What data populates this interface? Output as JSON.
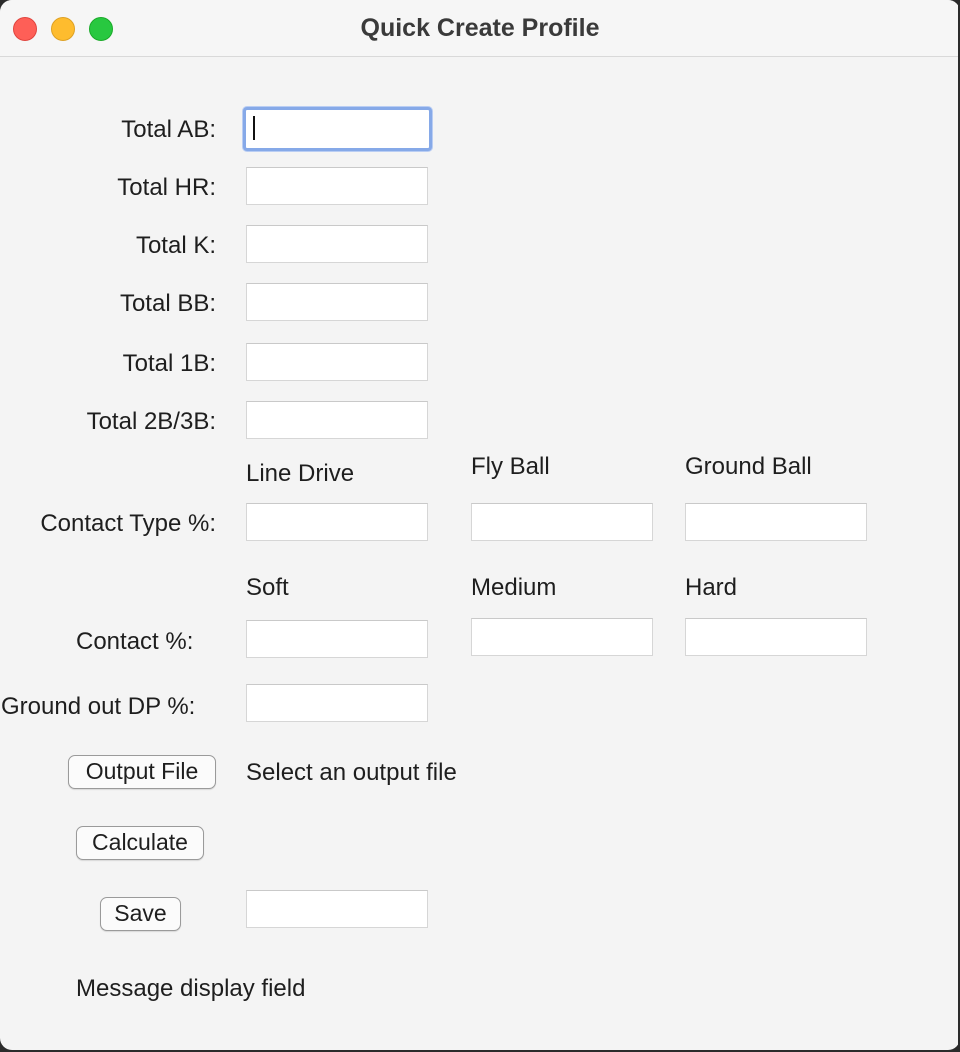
{
  "window": {
    "title": "Quick Create Profile"
  },
  "form": {
    "total_ab_label": "Total AB:",
    "total_hr_label": "Total HR:",
    "total_k_label": "Total K:",
    "total_bb_label": "Total BB:",
    "total_1b_label": "Total 1B:",
    "total_2b3b_label": "Total 2B/3B:",
    "contact_type": {
      "label": "Contact Type %:",
      "col1": "Line Drive",
      "col2": "Fly Ball",
      "col3": "Ground Ball"
    },
    "contact": {
      "label": "Contact %:",
      "col1": "Soft",
      "col2": "Medium",
      "col3": "Hard"
    },
    "ground_out_dp_label": "Ground out DP %:",
    "fields": {
      "total_ab": "",
      "total_hr": "",
      "total_k": "",
      "total_bb": "",
      "total_1b": "",
      "total_2b3b": "",
      "line_drive": "",
      "fly_ball": "",
      "ground_ball": "",
      "soft": "",
      "medium": "",
      "hard": "",
      "ground_out_dp": "",
      "save_name": ""
    }
  },
  "actions": {
    "output_file_label": "Output File",
    "output_file_status": "Select an output file",
    "calculate_label": "Calculate",
    "save_label": "Save"
  },
  "message": "Message display field"
}
